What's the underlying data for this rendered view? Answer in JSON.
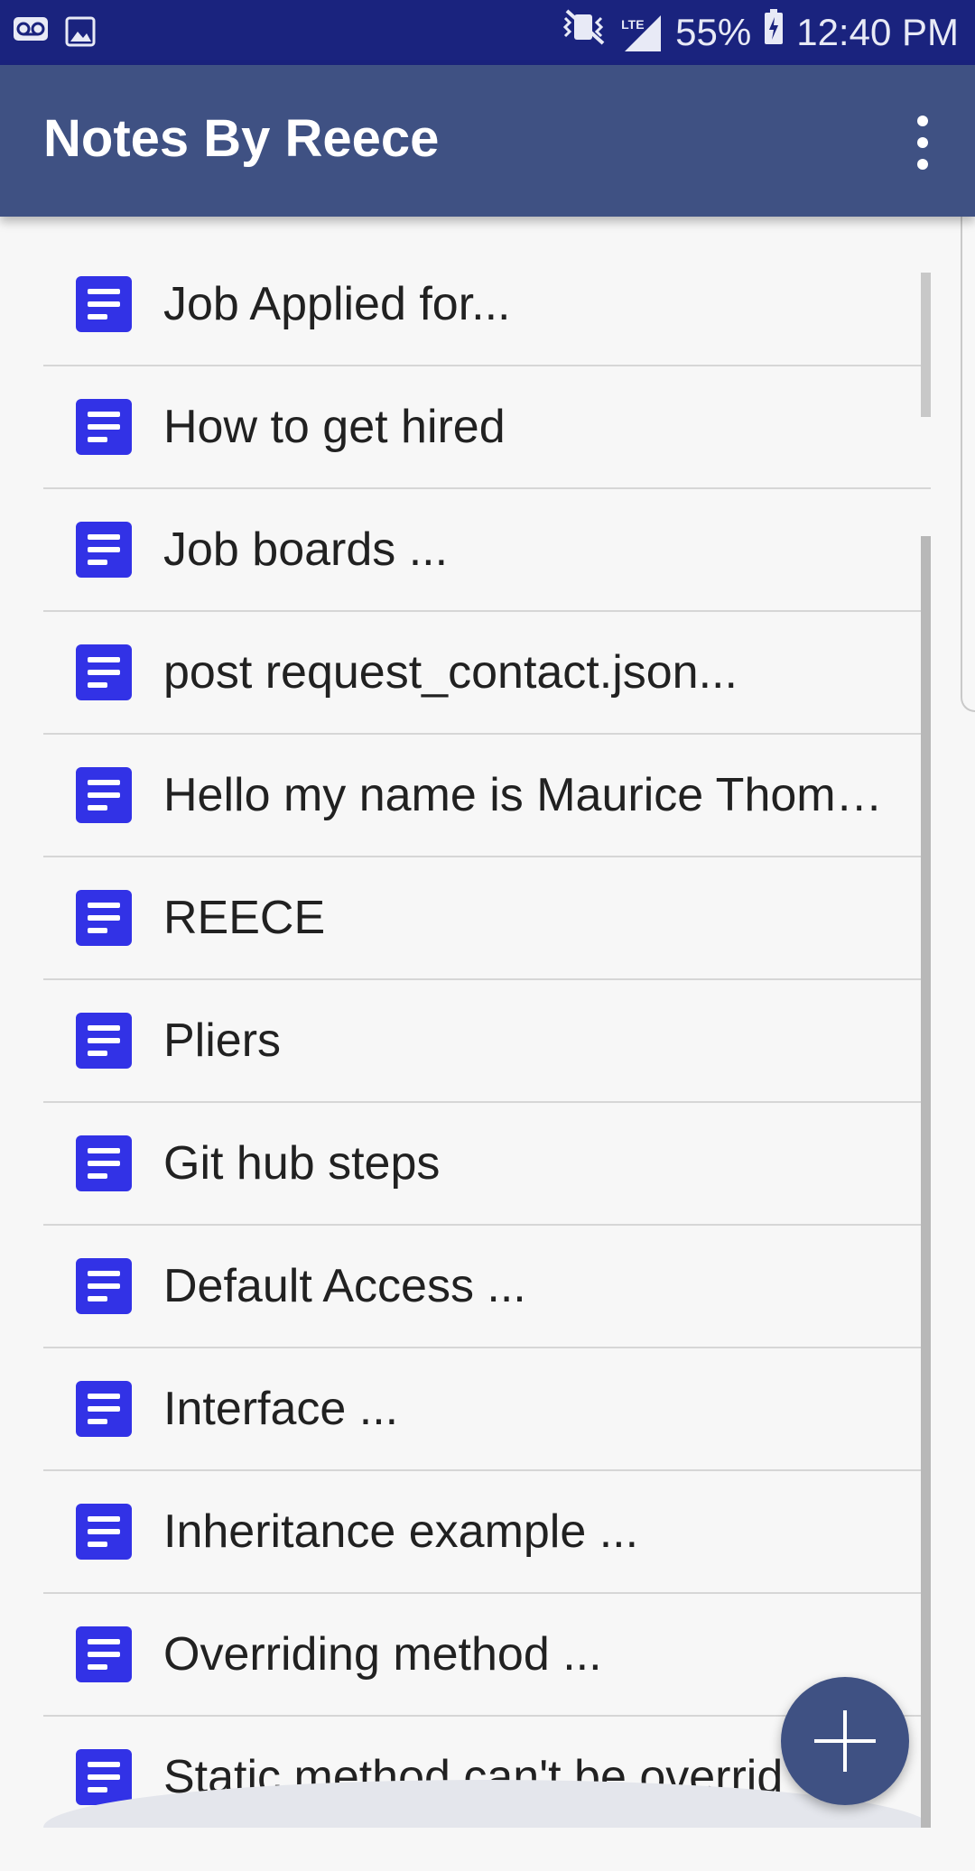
{
  "status_bar": {
    "left_icons": [
      "voicemail-icon",
      "image-icon"
    ],
    "right_icons": [
      "vibrate-mute-icon",
      "lte-signal-icon",
      "battery-charging-icon"
    ],
    "network_label": "LTE",
    "battery": "55%",
    "time": "12:40 PM"
  },
  "app_bar": {
    "title": "Notes By Reece",
    "menu_icon": "more-vert-icon"
  },
  "notes": [
    {
      "title": "Job Applied for...",
      "icon": "note-icon"
    },
    {
      "title": "How to get hired",
      "icon": "note-icon"
    },
    {
      "title": "Job boards ...",
      "icon": "note-icon"
    },
    {
      "title": "post request_contact.json...",
      "icon": "note-icon"
    },
    {
      "title": "Hello my name is Maurice Thom…",
      "icon": "note-icon"
    },
    {
      "title": "REECE",
      "icon": "note-icon"
    },
    {
      "title": "Pliers",
      "icon": "note-icon"
    },
    {
      "title": "Git hub steps",
      "icon": "note-icon"
    },
    {
      "title": "Default Access ...",
      "icon": "note-icon"
    },
    {
      "title": "Interface ...",
      "icon": "note-icon"
    },
    {
      "title": "Inheritance example ...",
      "icon": "note-icon"
    },
    {
      "title": "Overriding method ...",
      "icon": "note-icon"
    },
    {
      "title": "Static method can't be overrid",
      "icon": "note-icon"
    }
  ],
  "fab": {
    "icon": "plus-icon"
  },
  "colors": {
    "status_bar": "#1a237e",
    "app_bar": "#3f5183",
    "note_icon": "#3232e6",
    "fab": "#3f5183"
  }
}
